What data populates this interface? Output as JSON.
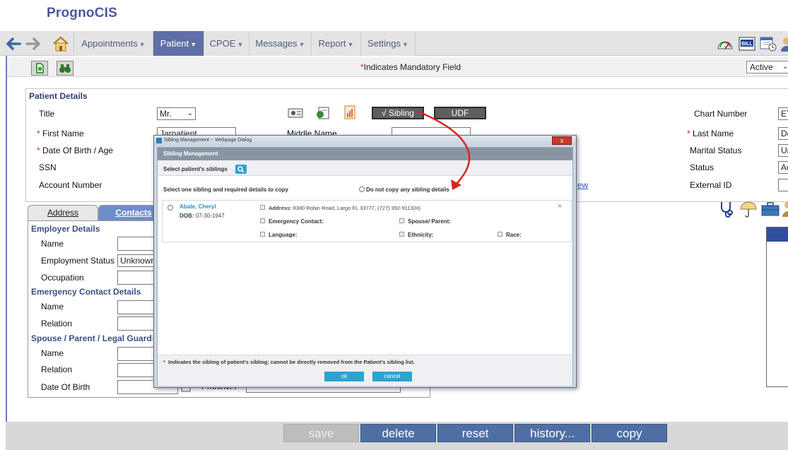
{
  "app": {
    "title": "PrognoCIS"
  },
  "nav": {
    "back_icon": "back-arrow-icon",
    "forward_icon": "forward-arrow-icon",
    "home_icon": "home-icon",
    "menus": [
      {
        "label": "Appointments"
      },
      {
        "label": "Patient"
      },
      {
        "label": "CPOE"
      },
      {
        "label": "Messages"
      },
      {
        "label": "Report"
      },
      {
        "label": "Settings"
      }
    ],
    "tool_icons": [
      "dashboard-gauge-icon",
      "bill-icon",
      "calendar-clock-icon",
      "user-icon"
    ]
  },
  "subbar": {
    "new_icon": "new-document-icon",
    "search_icon": "binoculars-icon",
    "mandatory_mark": "*",
    "mandatory_text": "Indicates Mandatory Field",
    "status_value": "Active"
  },
  "patient": {
    "section_title": "Patient Details",
    "title_label": "Title",
    "title_value": "Mr.",
    "first_name_label": "First Name",
    "first_name_value": "Jarpatient",
    "middle_name_label": "Middle Name",
    "dob_label": "Date Of Birth / Age",
    "ssn_label": "SSN",
    "account_label": "Account Number",
    "sibling_button": "√ Sibling",
    "udf_button": "UDF",
    "chart_label": "Chart Number",
    "chart_value": "EY",
    "last_name_label": "Last Name",
    "last_name_value": "Do",
    "marital_label": "Marital Status",
    "marital_value": "Ur",
    "status_label": "Status",
    "status_value": "Ac",
    "external_label": "External ID",
    "view_link": "ew",
    "req_mark": "*"
  },
  "tabs": {
    "address": "Address",
    "contacts": "Contacts"
  },
  "contacts": {
    "employer_title": "Employer Details",
    "name_label": "Name",
    "employment_status_label": "Employment Status",
    "employment_status_value": "Unknown",
    "occupation_label": "Occupation",
    "emergency_title": "Emergency Contact Details",
    "em_name_label": "Name",
    "em_relation_label": "Relation",
    "spouse_title": "Spouse / Parent / Legal Guardian",
    "sp_name_label": "Name",
    "sp_relation_label": "Relation",
    "sp_dob_label": "Date Of Birth",
    "employer_label": "Employer"
  },
  "dialog": {
    "window_title": "Sibling Management -- Webpage Dialog",
    "close_label": "x",
    "header": "Sibling Management",
    "select_label": "Select patient's siblings",
    "instruction": "Select one sibling and required details to copy",
    "no_copy_label": "Do not copy any sibling details",
    "sibling": {
      "name": "Abate, Cheryl",
      "dob_label": "DOB:",
      "dob_value": "07-30-1947",
      "address_label": "Address:",
      "address_value": "8380 Robin Road, Largo FL 33777, (727) 392-9113(H)",
      "emergency_label": "Emergency Contact:",
      "spouse_label": "Spouse/ Parent:",
      "language_label": "Language:",
      "ethnicity_label": "Ethnicity:",
      "race_label": "Race:",
      "remove_label": "×"
    },
    "footnote_mark": "*",
    "footnote": "Indicates the sibling of patient's sibling; cannot be directly removed from the Patient's sibling list.",
    "ok_label": "ok",
    "cancel_label": "cancel"
  },
  "actions": {
    "save": "save",
    "delete": "delete",
    "reset": "reset",
    "history": "history...",
    "copy": "copy"
  },
  "right_icons": [
    "stethoscope-icon",
    "umbrella-icon",
    "briefcase-icon",
    "user-icon"
  ],
  "colors": {
    "brand": "#4a5a9e",
    "active_menu": "#5c6fa7",
    "action_button": "#4f6fa3",
    "dialog_button": "#2ea3cf",
    "arrow": "#e02020"
  }
}
